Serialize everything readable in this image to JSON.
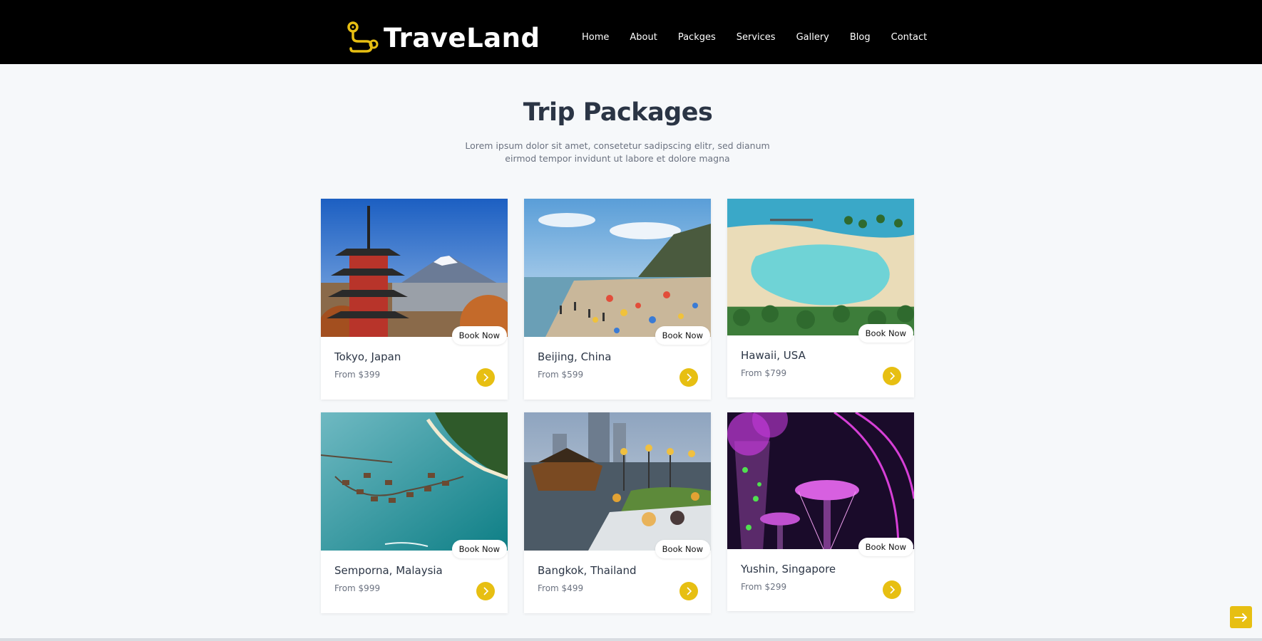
{
  "brand": {
    "name": "TraveLand",
    "accent": "#e7bf12"
  },
  "nav": [
    {
      "label": "Home"
    },
    {
      "label": "About"
    },
    {
      "label": "Packges"
    },
    {
      "label": "Services"
    },
    {
      "label": "Gallery"
    },
    {
      "label": "Blog"
    },
    {
      "label": "Contact"
    }
  ],
  "section": {
    "title": "Trip Packages",
    "subtitle": "Lorem ipsum dolor sit amet, consetetur sadipscing elitr, sed dianum eirmod tempor invidunt ut labore et dolore magna"
  },
  "packages": [
    {
      "name": "Tokyo, Japan",
      "price": "From $399",
      "book_label": "Book Now"
    },
    {
      "name": "Beijing, China",
      "price": "From $599",
      "book_label": "Book Now"
    },
    {
      "name": "Hawaii, USA",
      "price": "From $799",
      "book_label": "Book Now"
    },
    {
      "name": "Semporna, Malaysia",
      "price": "From $999",
      "book_label": "Book Now"
    },
    {
      "name": "Bangkok, Thailand",
      "price": "From $499",
      "book_label": "Book Now"
    },
    {
      "name": "Yushin, Singapore",
      "price": "From $299",
      "book_label": "Book Now"
    }
  ],
  "icons": {
    "logo": "map-pin-route-icon",
    "card_action": "chevron-right-icon",
    "scroll": "arrow-right-icon"
  }
}
